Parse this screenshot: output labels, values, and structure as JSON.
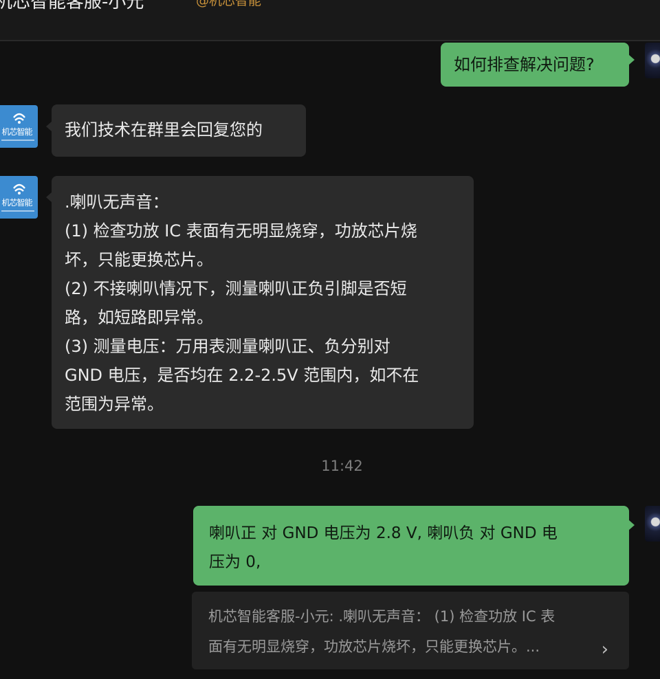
{
  "header": {
    "title": "机芯智能客服-小元",
    "tag": "@机芯智能"
  },
  "messages": [
    {
      "side": "right",
      "text": "如何排查解决问题?"
    },
    {
      "side": "left",
      "text": "我们技术在群里会回复您的"
    },
    {
      "side": "left",
      "lines": [
        ".喇叭无声音：",
        "(1) 检查功放 IC 表面有无明显烧穿，功放芯片烧",
        "坏，只能更换芯片。",
        "(2) 不接喇叭情况下，测量喇叭正负引脚是否短",
        "路，如短路即异常。",
        "(3) 测量电压：万用表测量喇叭正、负分别对",
        " GND 电压，是否均在 2.2-2.5V 范围内，如不在",
        "范围为异常。"
      ]
    },
    {
      "side": "right",
      "lines": [
        "喇叭正 对 GND 电压为 2.8 V,  喇叭负 对 GND 电",
        "压为 0,"
      ]
    }
  ],
  "timestamp": "11:42",
  "quote": {
    "lines": [
      "机芯智能客服-小元: .喇叭无声音：  (1) 检查功放 IC 表",
      "面有无明显烧穿，功放芯片烧坏，只能更换芯片。..."
    ],
    "arrow": "›"
  },
  "bot_avatar": {
    "logo_text": "机芯智能"
  },
  "colors": {
    "background": "#111111",
    "bubble_self": "#5cb36a",
    "bubble_other": "#2b2b2b",
    "tag": "#c8913a"
  }
}
